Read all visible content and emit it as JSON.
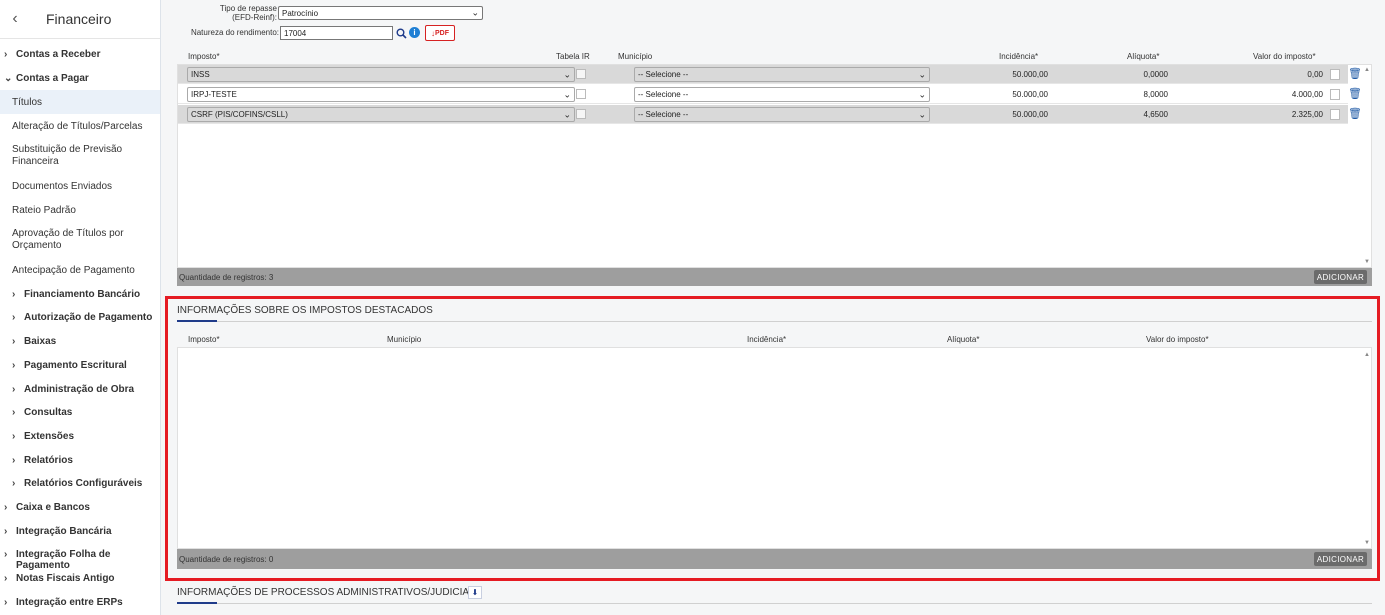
{
  "sidebar": {
    "back_icon": "chevron-left-icon",
    "title": "Financeiro",
    "items": [
      {
        "label": "Contas a Receber",
        "expanded": false
      },
      {
        "label": "Contas a Pagar",
        "expanded": true
      },
      {
        "label": "Títulos"
      },
      {
        "label": "Alteração de Títulos/Parcelas"
      },
      {
        "label": "Substituição de Previsão Financeira"
      },
      {
        "label": "Documentos Enviados"
      },
      {
        "label": "Rateio Padrão"
      },
      {
        "label": "Aprovação de Títulos por Orçamento"
      },
      {
        "label": "Antecipação de Pagamento"
      },
      {
        "label": "Financiamento Bancário"
      },
      {
        "label": "Autorização de Pagamento"
      },
      {
        "label": "Baixas"
      },
      {
        "label": "Pagamento Escritural"
      },
      {
        "label": "Administração de Obra"
      },
      {
        "label": "Consultas"
      },
      {
        "label": "Extensões"
      },
      {
        "label": "Relatórios"
      },
      {
        "label": "Relatórios Configuráveis"
      },
      {
        "label": "Caixa e Bancos"
      },
      {
        "label": "Integração Bancária"
      },
      {
        "label": "Integração Folha de Pagamento"
      },
      {
        "label": "Notas Fiscais Antigo"
      },
      {
        "label": "Integração entre ERPs"
      }
    ]
  },
  "form": {
    "tipo_repasse_label": "Tipo de repasse (EFD-Reinf):",
    "tipo_repasse_value": "Patrocínio",
    "natureza_label": "Natureza do rendimento:",
    "natureza_value": "17004",
    "pdf_label": "PDF"
  },
  "taxes_grid": {
    "headers": {
      "imposto": "Imposto*",
      "tabela_ir": "Tabela IR",
      "municipio": "Município",
      "incidencia": "Incidência*",
      "aliquota": "Alíquota*",
      "valor": "Valor do imposto*"
    },
    "rows": [
      {
        "imposto": "INSS",
        "municipio": "-- Selecione --",
        "incidencia": "50.000,00",
        "aliquota": "0,0000",
        "valor": "0,00"
      },
      {
        "imposto": "IRPJ-TESTE",
        "municipio": "-- Selecione --",
        "incidencia": "50.000,00",
        "aliquota": "8,0000",
        "valor": "4.000,00"
      },
      {
        "imposto": "CSRF (PIS/COFINS/CSLL)",
        "municipio": "-- Selecione --",
        "incidencia": "50.000,00",
        "aliquota": "4,6500",
        "valor": "2.325,00"
      }
    ],
    "count_label": "Quantidade de registros: 3",
    "add_label": "ADICIONAR"
  },
  "highlighted_taxes": {
    "title": "INFORMAÇÕES SOBRE OS IMPOSTOS DESTACADOS",
    "headers": {
      "imposto": "Imposto*",
      "municipio": "Município",
      "incidencia": "Incidência*",
      "aliquota": "Alíquota*",
      "valor": "Valor do imposto*"
    },
    "count_label": "Quantidade de registros: 0",
    "add_label": "ADICIONAR"
  },
  "processes": {
    "title": "INFORMAÇÕES DE PROCESSOS ADMINISTRATIVOS/JUDICIAIS"
  },
  "colors": {
    "accent": "#1f3b8a",
    "highlight": "#e51b23",
    "footer": "#9e9e9e",
    "button": "#6b6b6b"
  }
}
